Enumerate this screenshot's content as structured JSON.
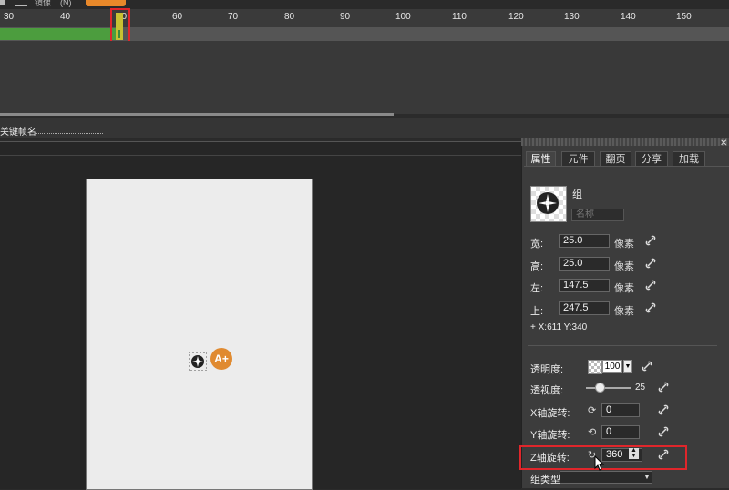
{
  "toolbar": {
    "items": [
      "镜像",
      "(N)"
    ],
    "accent": "#e8882a"
  },
  "timeline": {
    "ruler_ticks": [
      "30",
      "40",
      "50",
      "60",
      "70",
      "80",
      "90",
      "100",
      "110",
      "120",
      "130",
      "140",
      "150"
    ],
    "current_frame": "50",
    "track_color": "#4c9d3e",
    "keyframe_label": "关键帧名"
  },
  "stage": {
    "canvas_bg": "#ececec",
    "object_icon": "spinner-icon",
    "badge_label": "A+"
  },
  "panel": {
    "tabs": [
      "属性",
      "元件",
      "翻页",
      "分享",
      "加载"
    ],
    "active_tab": "属性",
    "group_title": "组",
    "name_placeholder": "名称",
    "props": [
      {
        "label": "宽:",
        "value": "25.0",
        "unit": "像素"
      },
      {
        "label": "高:",
        "value": "25.0",
        "unit": "像素"
      },
      {
        "label": "左:",
        "value": "147.5",
        "unit": "像素"
      },
      {
        "label": "上:",
        "value": "247.5",
        "unit": "像素"
      }
    ],
    "coord": "+ X:611 Y:340",
    "opacity_label": "透明度:",
    "opacity_value": "100",
    "perspective_label": "透视度:",
    "perspective_value": "25",
    "x_rot_label": "X轴旋转:",
    "x_rot_value": "0",
    "y_rot_label": "Y轴旋转:",
    "y_rot_value": "0",
    "z_rot_label": "Z轴旋转:",
    "z_rot_value": "360",
    "group_type_label": "组类型:",
    "group_type_value": ""
  },
  "highlight_color": "#e0262b"
}
